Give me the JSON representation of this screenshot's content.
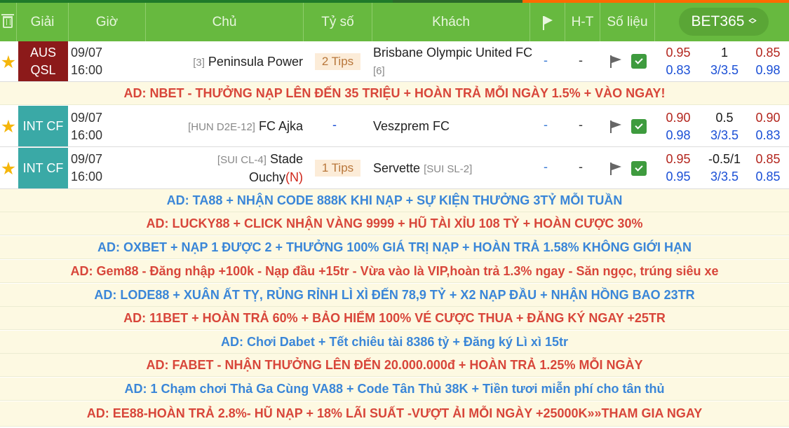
{
  "header": {
    "league": "Giải",
    "time": "Giờ",
    "home": "Chủ",
    "score": "Tỷ số",
    "away": "Khách",
    "ht": "H-T",
    "stats": "Số liệu",
    "bookmaker": "BET365"
  },
  "matches": [
    {
      "league": [
        "AUS",
        "QSL"
      ],
      "league_color": "#8c1a1a",
      "date": "09/07",
      "time": "16:00",
      "home_rank": "[3]",
      "home": "Peninsula Power",
      "score": "2 Tips",
      "away": "Brisbane Olympic United FC",
      "away_rank": "[6]",
      "ht1": "-",
      "ht2": "-",
      "odds": [
        [
          "0.95",
          "1",
          "0.85"
        ],
        [
          "0.83",
          "3/3.5",
          "0.98"
        ]
      ]
    },
    {
      "league": [
        "INT CF"
      ],
      "league_color": "#3aa9a6",
      "date": "09/07",
      "time": "16:00",
      "home_rank": "[HUN D2E-12]",
      "home": "FC Ajka",
      "score": "-",
      "away": "Veszprem FC",
      "away_rank": "",
      "ht1": "-",
      "ht2": "-",
      "odds": [
        [
          "0.90",
          "0.5",
          "0.90"
        ],
        [
          "0.98",
          "3/3.5",
          "0.83"
        ]
      ]
    },
    {
      "league": [
        "INT CF"
      ],
      "league_color": "#3aa9a6",
      "date": "09/07",
      "time": "16:00",
      "home_rank": "[SUI CL-4]",
      "home_line1": "Stade",
      "home_line2": "Ouchy",
      "home_flag": "(N)",
      "score": "1 Tips",
      "away": "Servette",
      "away_rank": "[SUI SL-2]",
      "ht1": "-",
      "ht2": "-",
      "odds": [
        [
          "0.95",
          "-0.5/1",
          "0.85"
        ],
        [
          "0.95",
          "3/3.5",
          "0.85"
        ]
      ]
    }
  ],
  "ads": [
    "AD: NBET - THƯỞNG NẠP LÊN ĐẾN 35 TRIỆU + HOÀN TRẢ MỖI NGÀY 1.5% + VÀO NGAY!",
    "AD: TA88 + NHẬN CODE 888K KHI NẠP + SỰ KIỆN THƯỞNG 3TỶ MỖI TUẦN",
    "AD: LUCKY88 + CLICK NHẬN VÀNG 9999 + HŨ TÀI XỈU 108 TỶ + HOÀN CƯỢC 30%",
    "AD: OXBET + NẠP 1 ĐƯỢC 2 + THƯỞNG 100% GIÁ TRỊ NẠP + HOÀN TRẢ 1.58% KHÔNG GIỚI HẠN",
    "AD: Gem88 - Đăng nhập +100k - Nạp đầu +15tr - Vừa vào là VIP,hoàn trả 1.3% ngay - Săn ngọc, trúng siêu xe",
    "AD: LODE88 + XUÂN ẤT TỴ, RỦNG RỈNH LÌ XÌ ĐẾN 78,9 TỶ + X2 NẠP ĐẦU + NHẬN HỒNG BAO 23TR",
    "AD: 11BET + HOÀN TRẢ 60% + BẢO HIỂM 100% VÉ CƯỢC THUA + ĐĂNG KÝ NGAY +25TR",
    "AD: Chơi Dabet + Tết chiêu tài 8386 tỷ + Đăng ký Lì xì 15tr",
    "AD: FABET - NHẬN THƯỞNG LÊN ĐẾN 20.000.000đ + HOÀN TRẢ 1.25% MỖI NGÀY",
    "AD: 1 Chạm chơi Thả Ga Cùng VA88 + Code Tân Thủ 38K + Tiền tươi miễn phí cho tân thủ",
    "AD: EE88-HOÀN TRẢ 2.8%- HŨ NẠP + 18% LÃI SUẤT -VƯỢT ẢI MỖI NGÀY +25000K»»THAM GIA NGAY"
  ],
  "colors": {
    "header_bg": "#67b93f",
    "ad_bg": "#fdf9e2",
    "ad_red": "#d8463a",
    "ad_blue": "#3a86d8",
    "star": "#f5b60b"
  }
}
